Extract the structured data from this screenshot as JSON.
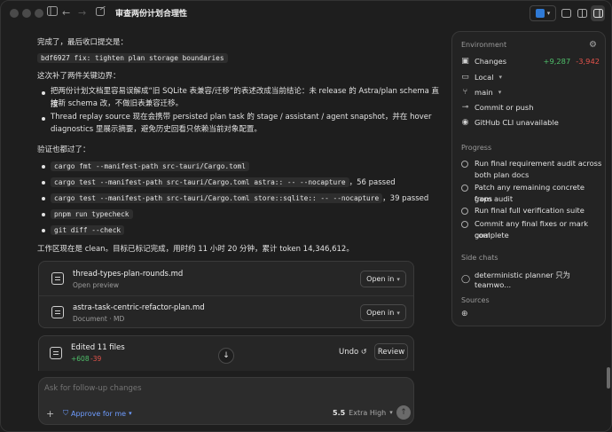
{
  "window": {
    "title": "审查两份计划合理性"
  },
  "header": {
    "app_badge_icon": "vscode-icon"
  },
  "chat": {
    "intro": "完成了，最后收口提交是：",
    "commit_code": "bdf6927 fix: tighten plan storage boundaries",
    "gaps_heading": "这次补了两件关键边界：",
    "bullet1_line1": "把两份计划文档里容易误解成“旧 SQLite 表兼容/迁移”的表述改成当前结论：未 release 的 Astra/plan schema 直接",
    "bullet1_line2": "按新 schema 改，不做旧表兼容迁移。",
    "bullet2_line1": "Thread replay source 现在会携带 persisted plan task 的 stage / assistant / agent snapshot，并在 hover",
    "bullet2_line2": "diagnostics 里展示摘要，避免历史回看只依赖当前对象配置。",
    "verify_heading": "验证也都过了：",
    "checks": [
      {
        "code": "cargo fmt --manifest-path src-tauri/Cargo.toml",
        "suffix": ""
      },
      {
        "code": "cargo test --manifest-path src-tauri/Cargo.toml astra:: -- --nocapture",
        "suffix": "，56 passed"
      },
      {
        "code": "cargo test --manifest-path src-tauri/Cargo.toml store::sqlite:: -- --nocapture",
        "suffix": "，39 passed"
      },
      {
        "code": "pnpm run typecheck",
        "suffix": ""
      },
      {
        "code": "git diff --check",
        "suffix": ""
      }
    ],
    "summary": "工作区现在是 clean。目标已标记完成，用时约 11 小时 20 分钟，累计 token 14,346,612。"
  },
  "files": [
    {
      "name": "thread-types-plan-rounds.md",
      "sub": "Open preview",
      "open_label": "Open in"
    },
    {
      "name": "astra-task-centric-refactor-plan.md",
      "sub": "Document · MD",
      "open_label": "Open in"
    }
  ],
  "edits": {
    "title": "Edited 11 files",
    "added": "+608",
    "removed": "-39",
    "undo_label": "Undo",
    "review_label": "Review"
  },
  "composer": {
    "placeholder": "Ask for follow-up changes",
    "approval_label": "Approve for me",
    "model": "5.5",
    "effort": "Extra High"
  },
  "panel": {
    "environment_heading": "Environment",
    "changes_label": "Changes",
    "changes_added": "+9,287",
    "changes_removed": "-3,942",
    "local_label": "Local",
    "branch_label": "main",
    "commit_label": "Commit or push",
    "gh_label": "GitHub CLI unavailable",
    "progress_heading": "Progress",
    "progress_items": [
      {
        "line1": "Run final requirement audit across",
        "line2": "both plan docs"
      },
      {
        "line1": "Patch any remaining concrete gaps",
        "line2": "from audit"
      },
      {
        "line1": "Run final full verification suite",
        "line2": ""
      },
      {
        "line1": "Commit any final fixes or mark goal",
        "line2": "complete"
      }
    ],
    "side_heading": "Side chats",
    "side_chat": "deterministic planner 只为 teamwo...",
    "sources_heading": "Sources"
  },
  "colors": {
    "added": "#4fbf6a",
    "removed": "#e5534b",
    "accent": "#6e9cff"
  }
}
